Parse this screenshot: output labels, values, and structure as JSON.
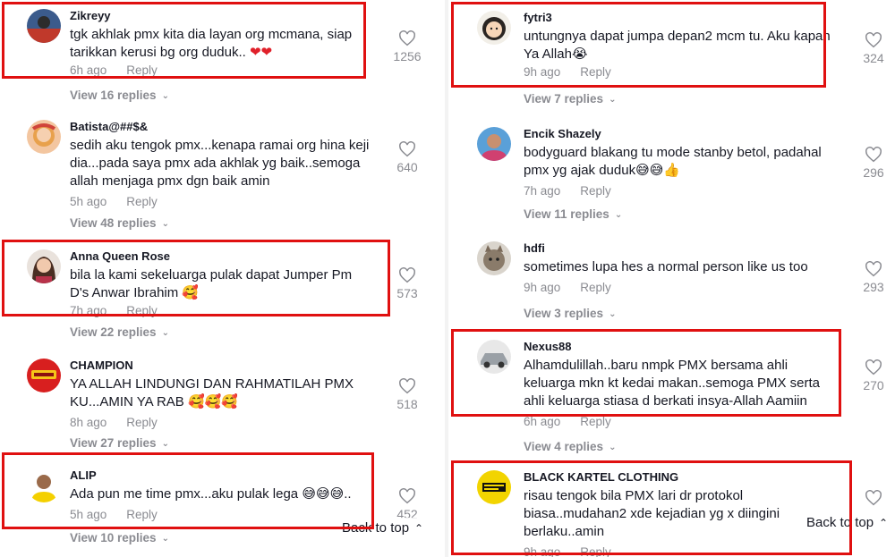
{
  "ui": {
    "reply_label": "Reply",
    "back_to_top": "Back to top"
  },
  "left": [
    {
      "username": "Zikreyy",
      "text": "tgk akhlak pmx kita dia layan org mcmana, siap tarikkan kerusi bg org duduk..",
      "time": "6h ago",
      "likes": "1256",
      "replies": "View 16 replies"
    },
    {
      "username": "Batista@##$&",
      "text": "sedih aku tengok pmx...kenapa ramai org hina keji dia...pada saya pmx ada akhlak yg baik..semoga allah menjaga pmx dgn baik amin",
      "time": "5h ago",
      "likes": "640",
      "replies": "View 48 replies"
    },
    {
      "username": "Anna Queen Rose",
      "text": "bila la kami sekeluarga pulak dapat Jumper Pm D's Anwar Ibrahim",
      "time": "7h ago",
      "likes": "573",
      "replies": "View 22 replies"
    },
    {
      "username": "CHAMPION",
      "text": "YA ALLAH LINDUNGI DAN RAHMATILAH PMX KU...AMIN YA RAB",
      "time": "8h ago",
      "likes": "518",
      "replies": "View 27 replies"
    },
    {
      "username": "ALIP",
      "text": "Ada pun me time pmx...aku pulak lega",
      "time": "5h ago",
      "likes": "452",
      "replies": "View 10 replies"
    }
  ],
  "right": [
    {
      "username": "fytri3",
      "text": "untungnya dapat jumpa depan2 mcm tu. Aku kapan Ya Allah",
      "time": "9h ago",
      "likes": "324",
      "replies": "View 7 replies"
    },
    {
      "username": "Encik Shazely",
      "text": "bodyguard blakang tu mode stanby betol, padahal pmx yg ajak duduk",
      "time": "7h ago",
      "likes": "296",
      "replies": "View 11 replies"
    },
    {
      "username": "hdfi",
      "text": "sometimes lupa hes a normal person like us too",
      "time": "9h ago",
      "likes": "293",
      "replies": "View 3 replies"
    },
    {
      "username": "Nexus88",
      "text": "Alhamdulillah..baru nmpk PMX bersama ahli keluarga mkn kt kedai makan..semoga PMX serta ahli keluarga stiasa d berkati insya-Allah Aamiin",
      "time": "6h ago",
      "likes": "270",
      "replies": "View 4 replies"
    },
    {
      "username": "BLACK KARTEL CLOTHING",
      "text": "risau tengok bila PMX lari dr protokol biasa..mudahan2 xde kejadian yg x diingini berlaku..amin",
      "time": "9h ago",
      "likes": "",
      "replies": ""
    }
  ],
  "colors": {
    "highlight": "#e01010",
    "muted": "#8a8b91",
    "text": "#161823"
  },
  "icons": {
    "like": "heart-outline-icon",
    "chevron": "chevron-down-icon",
    "back_to_top": "double-chevron-up-icon"
  }
}
